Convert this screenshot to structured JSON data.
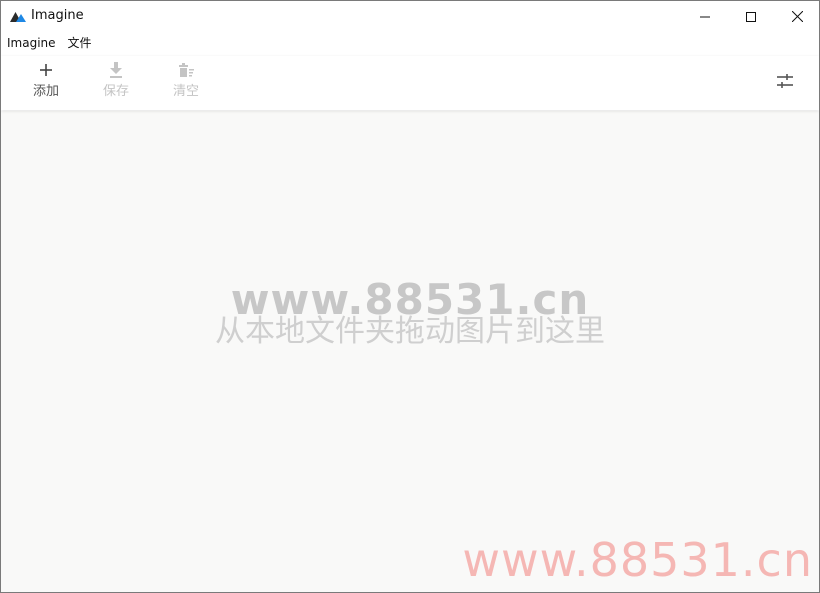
{
  "window": {
    "title": "Imagine",
    "controls": {
      "minimize_icon": "minimize-icon",
      "maximize_icon": "maximize-icon",
      "close_icon": "close-icon"
    }
  },
  "menubar": {
    "items": [
      {
        "label": "Imagine"
      },
      {
        "label": "文件"
      }
    ]
  },
  "toolbar": {
    "add_label": "添加",
    "save_label": "保存",
    "clear_label": "清空",
    "settings_icon": "sliders-icon"
  },
  "content": {
    "drop_hint": "从本地文件夹拖动图片到这里",
    "watermark_main": "www.88531.cn",
    "watermark_corner": "www.88531.cn"
  },
  "colors": {
    "accent": "#1a73e8",
    "disabled": "#c4c4c4",
    "content_bg": "#f9f9f8",
    "watermark_red": "#f5b7b4"
  }
}
